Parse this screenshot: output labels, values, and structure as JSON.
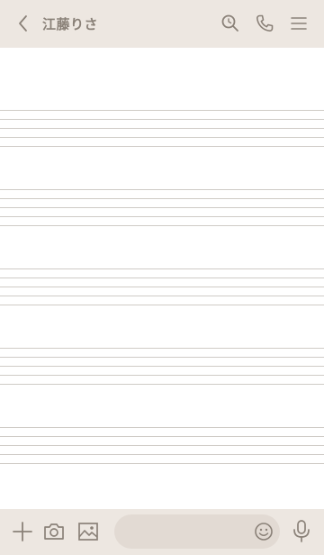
{
  "header": {
    "title": "江藤りさ",
    "icons": [
      "back-chevron-icon",
      "search-icon",
      "phone-icon",
      "menu-icon"
    ]
  },
  "chat": {
    "staff_count": 5,
    "lines_per_staff": 5
  },
  "footer": {
    "icons": [
      "plus-icon",
      "camera-icon",
      "image-icon",
      "emoji-icon",
      "microphone-icon"
    ],
    "message_input": {
      "value": "",
      "placeholder": ""
    }
  },
  "colors": {
    "bar_background": "#ede7e1",
    "icon": "#8a8178",
    "staff_line": "#cfcbc6",
    "input_background": "#e2dad3",
    "chat_background": "#ffffff"
  }
}
